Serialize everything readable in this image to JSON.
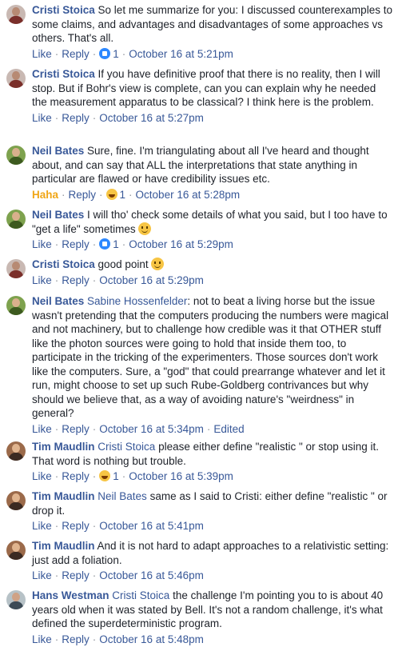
{
  "labels": {
    "like": "Like",
    "reply": "Reply",
    "haha": "Haha",
    "edited": "Edited",
    "separator": "·"
  },
  "comments": [
    {
      "author": "Cristi Stoica",
      "text": "So let me summarize for you: I discussed counterexamples to some claims, and advantages and disadvantages of some approaches vs others. That's all.",
      "reaction_count": "1",
      "time": "October 16 at 5:21pm"
    },
    {
      "author": "Cristi Stoica",
      "text": "If you have definitive proof that there is no reality, then I will stop. But if Bohr's view is complete, can you can explain why he needed the measurement apparatus to be classical? I think here is the problem.",
      "time": "October 16 at 5:27pm"
    },
    {
      "author": "Neil Bates",
      "text": "Sure, fine. I'm triangulating about all I've heard and thought about, and can say that ALL the interpretations that state anything in particular are flawed or have credibility issues etc.",
      "reaction_count": "1",
      "time": "October 16 at 5:28pm"
    },
    {
      "author": "Neil Bates",
      "text": "I will tho' check some details of what you said, but I too have to \"get a life\" sometimes",
      "reaction_count": "1",
      "time": "October 16 at 5:29pm"
    },
    {
      "author": "Cristi Stoica",
      "text": "good point",
      "time": "October 16 at 5:29pm"
    },
    {
      "author": "Neil Bates",
      "mention": "Sabine Hossenfelder",
      "text": ": not to beat a living horse but the issue wasn't pretending that the computers producing the numbers were magical and not machinery, but to challenge how credible was it that OTHER stuff like the photon sources were going to hold that inside them too, to participate in the tricking of the experimenters. Those sources don't work like the computers. Sure, a \"god\" that could prearrange whatever and let it run, might choose to set up such Rube-Goldberg contrivances but why should we believe that, as a way of avoiding nature's \"weirdness\" in general?",
      "time": "October 16 at 5:34pm"
    },
    {
      "author": "Tim Maudlin",
      "mention": "Cristi Stoica",
      "text": "please either define \"realistic \" or stop using it. That word is nothing but trouble.",
      "reaction_count": "1",
      "time": "October 16 at 5:39pm"
    },
    {
      "author": "Tim Maudlin",
      "mention": "Neil Bates",
      "text": "same as I said to Cristi: either define \"realistic \" or drop it.",
      "time": "October 16 at 5:41pm"
    },
    {
      "author": "Tim Maudlin",
      "text": "And it is not hard to adapt approaches to a relativistic setting: just add a foliation.",
      "time": "October 16 at 5:46pm"
    },
    {
      "author": "Hans Westman",
      "mention": "Cristi Stoica",
      "text": "the challenge I'm pointing you to is about 40 years old when it was stated by Bell. It's not a random challenge, it's what defined the superdeterministic program.",
      "time": "October 16 at 5:48pm"
    }
  ],
  "colors": {
    "link": "#385898",
    "text": "#1d2129",
    "meta": "#90949c",
    "haha": "#f0a617",
    "like_reaction": "#2d88ff"
  }
}
